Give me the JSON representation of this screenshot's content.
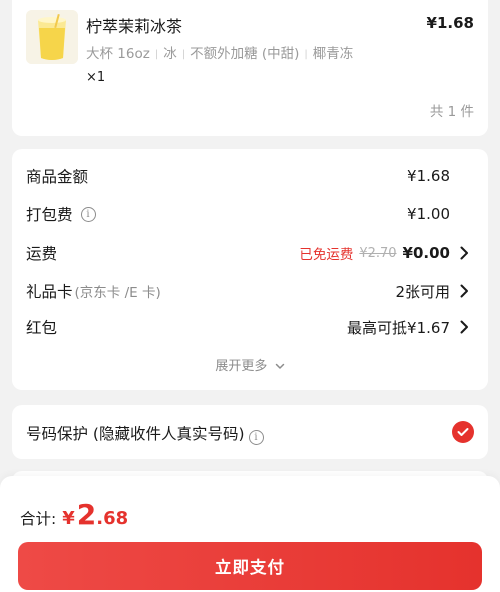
{
  "product": {
    "name": "柠萃茉莉冰茶",
    "price": "¥1.68",
    "specs": [
      "大杯 16oz",
      "冰",
      "不额外加糖 (中甜)",
      "椰青冻"
    ],
    "quantity": "×1",
    "count_text": "共 1 件"
  },
  "price_details": {
    "goods_amount_label": "商品金额",
    "goods_amount_value": "¥1.68",
    "packing_label": "打包费",
    "packing_value": "¥1.00",
    "shipping_label": "运费",
    "shipping_free_text": "已免运费",
    "shipping_original": "¥2.70",
    "shipping_value": "¥0.00",
    "giftcard_label": "礼品卡",
    "giftcard_sub": "(京东卡 /E 卡)",
    "giftcard_value": "2张可用",
    "redpacket_label": "红包",
    "redpacket_value": "最高可抵¥1.67",
    "expand_more": "展开更多"
  },
  "protection": {
    "label": "号码保护 (隐藏收件人真实号码)",
    "checked": true
  },
  "footer": {
    "total_label": "合计:",
    "currency": "¥",
    "total_int": "2",
    "total_dec": ".68",
    "pay_button": "立即支付"
  },
  "colors": {
    "accent_red": "#e5322d",
    "background": "#f2f2f2"
  }
}
